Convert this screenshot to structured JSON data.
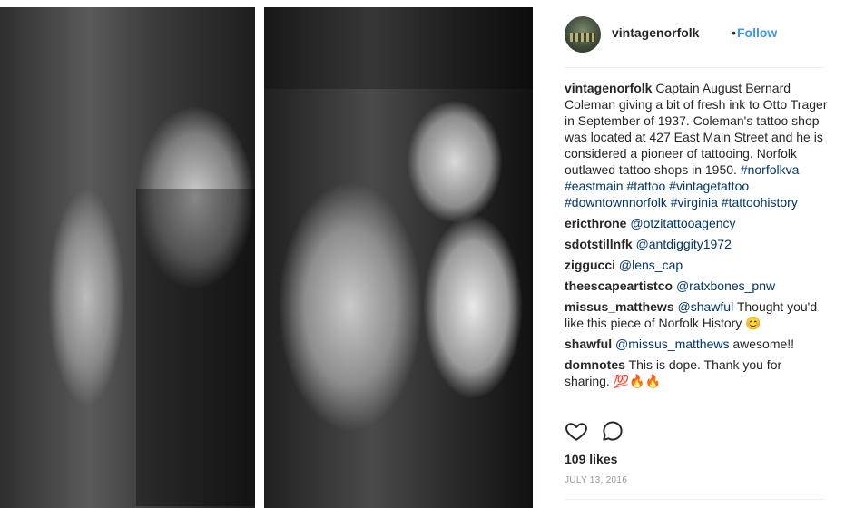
{
  "post": {
    "username": "vintagenorfolk",
    "separator": "•",
    "follow_label": "Follow",
    "likes": "109 likes",
    "date": "JULY 13, 2016"
  },
  "caption": {
    "user": "vintagenorfolk",
    "text": "Captain August Bernard Coleman giving a bit of fresh ink to Otto Trager in September of 1937. Coleman's tattoo shop was located at 427 East Main Street and he is considered a pioneer of tattooing. Norfolk outlawed tattoo shops in 1950.",
    "hashtags": "#norfolkva #eastmain #tattoo #vintagetattoo #downtownnorfolk #virginia #tattoohistory"
  },
  "comments": [
    {
      "user": "ericthrone",
      "mention": "@otzitattooagency",
      "text": ""
    },
    {
      "user": "sdotstillnfk",
      "mention": "@antdiggity1972",
      "text": ""
    },
    {
      "user": "ziggucci",
      "mention": "@lens_cap",
      "text": ""
    },
    {
      "user": "theescapeartistco",
      "mention": "@ratxbones_pnw",
      "text": ""
    },
    {
      "user": "missus_matthews",
      "mention": "@shawful",
      "text": "Thought you'd like this piece of Norfolk History 😊"
    },
    {
      "user": "shawful",
      "mention": "@missus_matthews",
      "text": "awesome!!"
    },
    {
      "user": "domnotes",
      "mention": "",
      "text": "This is dope. Thank you for sharing. 💯🔥🔥"
    }
  ],
  "icons": {
    "like": "heart-icon",
    "comment": "comment-icon"
  },
  "colors": {
    "link": "#003569",
    "follow": "#3897f0",
    "text": "#262626",
    "muted": "#999999"
  }
}
